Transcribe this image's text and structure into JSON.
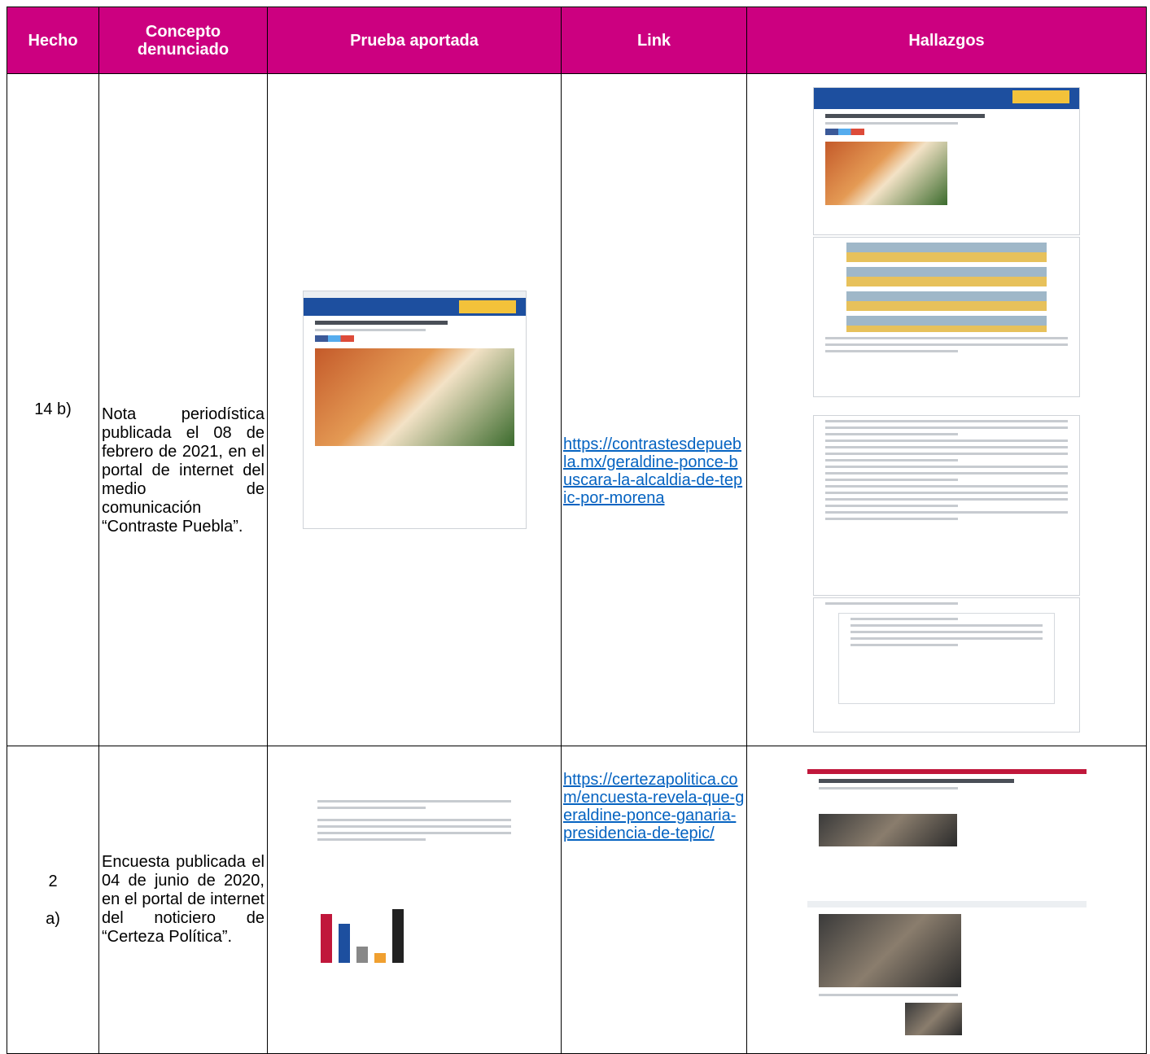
{
  "headers": {
    "hecho": "Hecho",
    "concepto": "Concepto denunciado",
    "prueba": "Prueba aportada",
    "link": "Link",
    "hallazgos": "Hallazgos"
  },
  "rows": [
    {
      "hecho": "14 b)",
      "concepto": "Nota periodística publicada el 08 de febrero de 2021, en el portal de internet del medio de comunicación “Contraste Puebla”.",
      "link": "https://contrastesdepuebla.mx/geraldine-ponce-buscara-la-alcaldia-de-tepic-por-morena"
    },
    {
      "hecho_num": "2",
      "hecho_letter": "a)",
      "concepto": "Encuesta publicada el 04 de junio de 2020, en el portal de internet del noticiero de “Certeza Política”.",
      "link": "https://certezapolitica.com/encuesta-revela-que-geraldine-ponce-ganaria-presidencia-de-tepic/"
    }
  ],
  "colors": {
    "header_bg": "#cc0080",
    "header_text": "#ffffff",
    "link": "#0563c1"
  }
}
